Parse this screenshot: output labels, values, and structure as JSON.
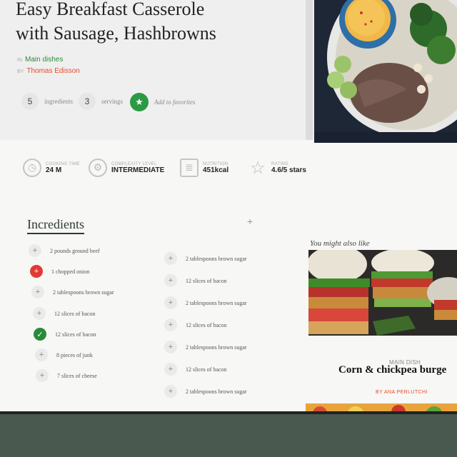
{
  "recipe": {
    "title_line1": "Easy Breakfast Casserole",
    "title_line2": "with Sausage, Hashbrowns",
    "category_prefix": "in",
    "category": "Main dishes",
    "author_prefix": "by",
    "author": "Thomas Edisson",
    "ingredients_count": "5",
    "ingredients_label": "ingredients",
    "servings_count": "3",
    "servings_label": "servings",
    "favorites_label": "Add to favorites"
  },
  "stats": [
    {
      "label": "Cooking time",
      "value": "24 M",
      "icon": "clock-icon"
    },
    {
      "label": "Complexity level",
      "value": "INTERMEDIATE",
      "icon": "gears-icon"
    },
    {
      "label": "Nutrition",
      "value": "451kcal",
      "icon": "nutrition-icon"
    },
    {
      "label": "Rating",
      "value": "4.6/5 stars",
      "icon": "star-icon"
    }
  ],
  "ingredients": {
    "title": "Incredients",
    "add_symbol": "+",
    "col1": [
      {
        "text": "2 pounds ground beef",
        "state": "plus"
      },
      {
        "text": "1 chopped onion",
        "state": "red-plus"
      },
      {
        "text": "2 tablespoons brown sugar",
        "state": "plus"
      },
      {
        "text": "12 slices of bacon",
        "state": "plus"
      },
      {
        "text": "12 slices of bacon",
        "state": "checked"
      },
      {
        "text": "8 pieces of junk",
        "state": "plus"
      },
      {
        "text": "7 slices of cheese",
        "state": "plus"
      }
    ],
    "col2": [
      {
        "text": "2 tablespoons brown sugar",
        "state": "plus"
      },
      {
        "text": "12 slices of bacon",
        "state": "plus"
      },
      {
        "text": "2 tablespoons brown sugar",
        "state": "plus"
      },
      {
        "text": "12 slices of bacon",
        "state": "plus"
      },
      {
        "text": "2 tablespoons brown sugar",
        "state": "plus"
      },
      {
        "text": "12 slices of bacon",
        "state": "plus"
      },
      {
        "text": "2 tablespoons brown sugar",
        "state": "plus"
      }
    ]
  },
  "suggest": {
    "heading": "You might also like",
    "category": "MAIN DISH",
    "title": "Corn & chickpea burge",
    "author": "BY ANA PERLUTCHI"
  },
  "colors": {
    "accent_green": "#2a9a43",
    "accent_red": "#e14b2b"
  }
}
